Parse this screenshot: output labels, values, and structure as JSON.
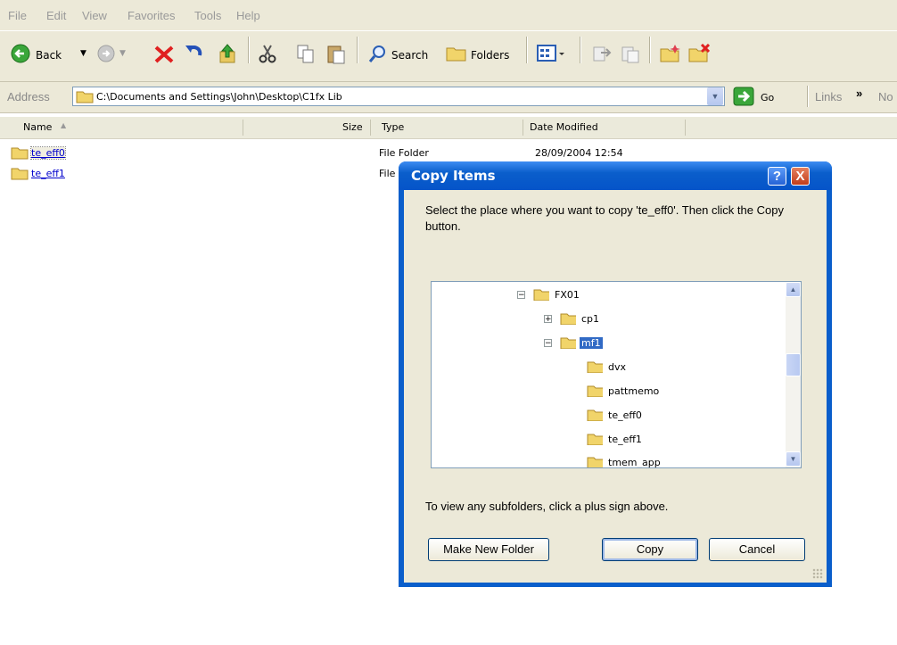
{
  "menu": [
    "File",
    "Edit",
    "View",
    "Favorites",
    "Tools",
    "Help"
  ],
  "toolbar": {
    "back_label": "Back",
    "search_label": "Search",
    "folders_label": "Folders"
  },
  "address": {
    "label": "Address",
    "path": "C:\\Documents and Settings\\John\\Desktop\\C1fx Lib",
    "go_label": "Go",
    "links_label": "Links",
    "overflow_label": "No"
  },
  "columns": {
    "name": "Name",
    "size": "Size",
    "type": "Type",
    "date": "Date Modified"
  },
  "files": [
    {
      "name": "te_eff0",
      "type": "File Folder",
      "date": "28/09/2004 12:54"
    },
    {
      "name": "te_eff1",
      "type": "File",
      "date": ""
    }
  ],
  "dialog": {
    "title": "Copy Items",
    "help": "?",
    "close": "X",
    "instructions": "Select the place where you want to copy 'te_eff0'. Then click the Copy button.",
    "hint": "To view any subfolders, click a plus sign above.",
    "make_folder": "Make New Folder",
    "copy": "Copy",
    "cancel": "Cancel",
    "tree": [
      "FX01",
      "cp1",
      "mf1",
      "dvx",
      "pattmemo",
      "te_eff0",
      "te_eff1",
      "tmem_app"
    ],
    "selected": "mf1"
  },
  "colors": {
    "selection": "#316ac5",
    "titlebar": "#0a5ecb",
    "chrome": "#ece9d8"
  }
}
